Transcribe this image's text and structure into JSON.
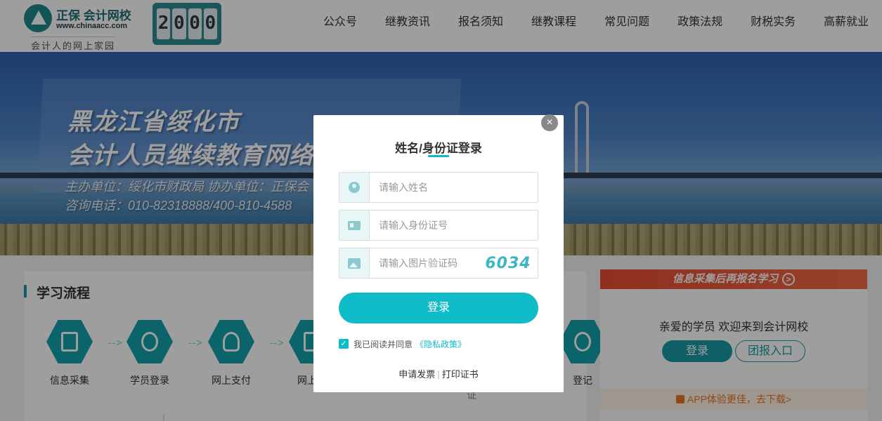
{
  "header": {
    "logo_brand": "正保",
    "logo_school": "会计网校",
    "logo_url": "www.chinaacc.com",
    "logo_slogan": "会计人的网上家园",
    "counter_digits": [
      "2",
      "0",
      "0",
      "0"
    ],
    "nav_items": [
      "公众号",
      "继教资讯",
      "报名须知",
      "继教课程",
      "常见问题",
      "政策法规",
      "财税实务",
      "高薪就业"
    ]
  },
  "banner": {
    "title_line1": "黑龙江省绥化市",
    "title_line2": "会计人员继续教育网络",
    "sub_line1": "主办单位：绥化市财政局    协办单位：正保会",
    "sub_line2": "咨询电话：010-82318888/400-810-4588"
  },
  "process": {
    "title": "学习流程",
    "steps": [
      "信息采集",
      "学员登录",
      "网上支付",
      "网上学",
      "登记"
    ],
    "arrow": "-->"
  },
  "right_panel": {
    "info_banner": "信息采集后再报名学习",
    "info_icon": "arrow-right-circle-icon",
    "welcome": "亲爱的学员 欢迎来到会计网校",
    "login_label": "登录",
    "group_label": "团报入口",
    "app_tip": "APP体验更佳，去下载>"
  },
  "modal": {
    "close_symbol": "×",
    "title": "姓名/身份证登录",
    "name_placeholder": "请输入姓名",
    "id_placeholder": "请输入身份证号",
    "captcha_placeholder": "请输入图片验证码",
    "captcha_text": "6034",
    "submit_label": "登录",
    "agree_text": "我已阅读并同意",
    "policy_link": "《隐私政策》",
    "checkbox_checked": true,
    "invoice_link": "申请发票",
    "link_separator": "|",
    "certificate_link": "打印证书",
    "stray_char": "证"
  },
  "colors": {
    "accent": "#0fbcc8",
    "brand_teal": "#1b9aa6",
    "promo_red": "#e94d35",
    "app_orange": "#e87722"
  }
}
